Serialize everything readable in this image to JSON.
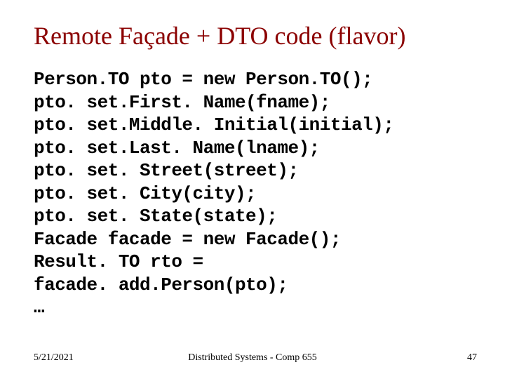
{
  "title": "Remote Façade + DTO code (flavor)",
  "code": {
    "l0": "Person.TO pto = new Person.TO();",
    "l1": "pto. set.First. Name(fname);",
    "l2": "pto. set.Middle. Initial(initial);",
    "l3": "pto. set.Last. Name(lname);",
    "l4": "pto. set. Street(street);",
    "l5": "pto. set. City(city);",
    "l6": "pto. set. State(state);",
    "l7": "Facade facade = new Facade();",
    "l8": "Result. TO rto =",
    "l9": "facade. add.Person(pto);",
    "l10": "…"
  },
  "footer": {
    "date": "5/21/2021",
    "center": "Distributed Systems - Comp 655",
    "page": "47"
  }
}
